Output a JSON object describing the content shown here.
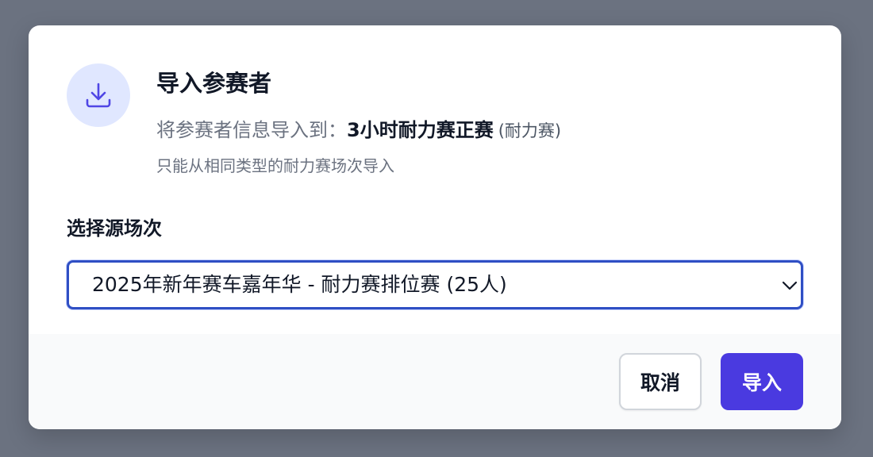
{
  "dialog": {
    "title": "导入参赛者",
    "target_prefix": "将参赛者信息导入到：",
    "target_name": "3小时耐力赛正赛",
    "target_type": "(耐力赛)",
    "hint": "只能从相同类型的耐力赛场次导入",
    "icon": "download-icon"
  },
  "source_select": {
    "label": "选择源场次",
    "selected": "2025年新年赛车嘉年华 - 耐力赛排位赛 (25人)",
    "icon": "chevron-down-icon"
  },
  "footer": {
    "cancel_label": "取消",
    "import_label": "导入"
  },
  "colors": {
    "overlay": "#6b7280",
    "accent": "#4a3ae0",
    "icon_bg": "#e0e7ff",
    "focus_border": "#2f4fc4"
  }
}
